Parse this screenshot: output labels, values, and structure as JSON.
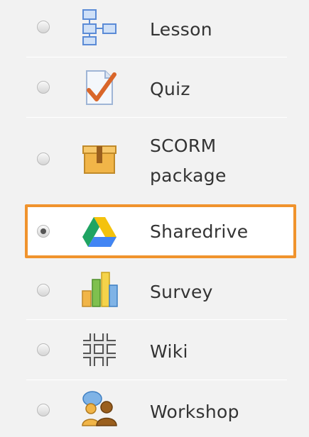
{
  "activities": [
    {
      "label": "Lesson",
      "icon": "lesson-icon",
      "selected": false
    },
    {
      "label": "Quiz",
      "icon": "quiz-icon",
      "selected": false
    },
    {
      "label_lines": [
        "SCORM",
        "package"
      ],
      "icon": "scorm-package-icon",
      "selected": false
    },
    {
      "label": "Sharedrive",
      "icon": "google-drive-icon",
      "selected": true
    },
    {
      "label": "Survey",
      "icon": "survey-icon",
      "selected": false
    },
    {
      "label": "Wiki",
      "icon": "wiki-icon",
      "selected": false
    },
    {
      "label": "Workshop",
      "icon": "workshop-icon",
      "selected": false
    }
  ],
  "colors": {
    "highlight": "#f0932d",
    "background": "#f2f2f2",
    "text": "#333333"
  }
}
